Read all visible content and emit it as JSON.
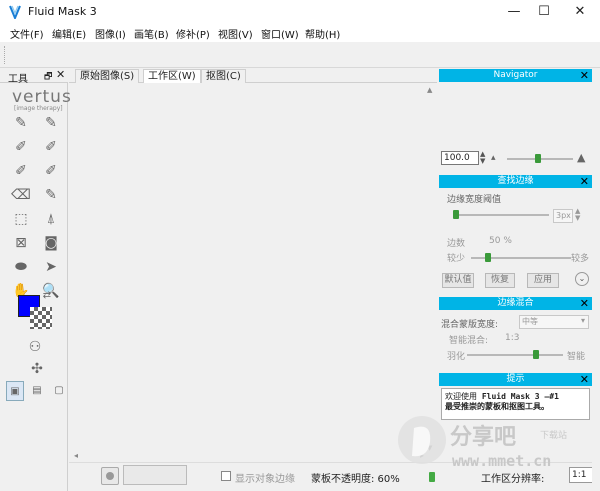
{
  "window": {
    "title": "Fluid Mask 3",
    "minimize": "—",
    "maximize": "☐",
    "close": "✕"
  },
  "menu": [
    {
      "label": "文件(F)"
    },
    {
      "label": "编辑(E)"
    },
    {
      "label": "图像(I)"
    },
    {
      "label": "画笔(B)"
    },
    {
      "label": "修补(P)"
    },
    {
      "label": "视图(V)"
    },
    {
      "label": "窗口(W)"
    },
    {
      "label": "帮助(H)"
    }
  ],
  "tools": {
    "title": "工具",
    "pin": "🗗",
    "close": "✕",
    "logo": "vertus",
    "logo_sub": "[image therapy]",
    "fg_color": "#0000ff"
  },
  "tabs": [
    {
      "label": "原始图像(S)"
    },
    {
      "label": "工作区(W)"
    },
    {
      "label": "抠图(C)"
    }
  ],
  "navigator": {
    "title": "Navigator",
    "close": "✕",
    "zoom": "100.0"
  },
  "edge": {
    "title": "查找边缘",
    "close": "✕",
    "threshold_label": "边缘宽度阈值",
    "threshold_value": "3px",
    "count_label": "边数",
    "count_value": "50 %",
    "less": "较少",
    "more": "较多",
    "btn_default": "默认值",
    "btn_restore": "恢复",
    "btn_apply": "应用"
  },
  "blend": {
    "title": "边缘混合",
    "close": "✕",
    "width_label": "混合蒙版宽度:",
    "width_value": "中等",
    "smart_label": "智能混合:",
    "smart_value": "1:3",
    "feather": "羽化",
    "smart": "智能"
  },
  "tips": {
    "title": "提示",
    "close": "✕",
    "line1_a": "欢迎使用 ",
    "line1_b": "Fluid Mask 3 —#1",
    "line2": "最受推崇的蒙板和抠图工具。"
  },
  "status": {
    "show_edges": "显示对象边缘",
    "opacity": "蒙板不透明度: 60%",
    "opacity_value": 0.6,
    "work_preview": "工作区分辨率:",
    "zoom": "1:1"
  },
  "watermark": {
    "brand": "分享吧",
    "sub": "下载站",
    "url": "www.mmet.cn"
  }
}
